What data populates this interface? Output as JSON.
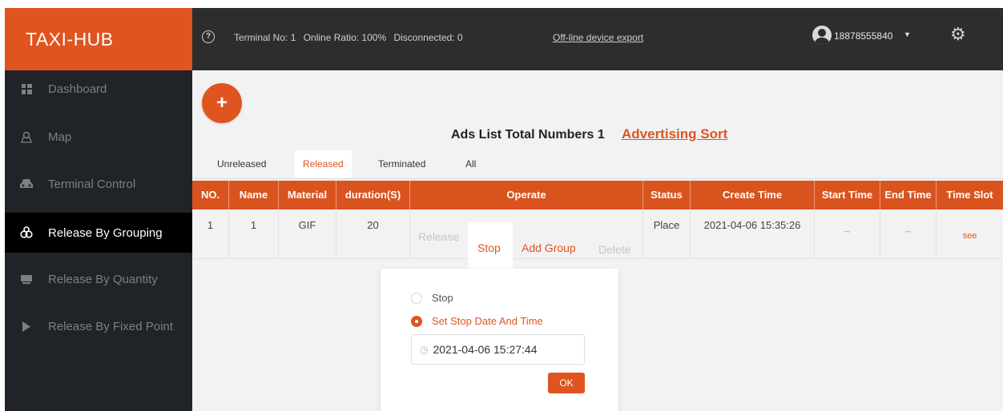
{
  "header": {
    "brand": "TAXI-HUB",
    "terminal_no": "Terminal No: 1",
    "online_ratio": "Online Ratio: 100%",
    "disconnected": "Disconnected: 0",
    "export_link": "Off-line device export",
    "user_phone": "18878555840",
    "icons": [
      "help-icon",
      "avatar",
      "chevron-down-icon",
      "gear-icon"
    ]
  },
  "sidebar": {
    "items": [
      {
        "label": "Dashboard",
        "icon": "dashboard-icon"
      },
      {
        "label": "Map",
        "icon": "map-icon"
      },
      {
        "label": "Terminal Control",
        "icon": "car-icon"
      },
      {
        "label": "Release By Grouping",
        "icon": "group-icon",
        "active": true
      },
      {
        "label": "Release By Quantity",
        "icon": "quantity-icon"
      },
      {
        "label": "Release By Fixed Point",
        "icon": "play-icon"
      }
    ]
  },
  "main": {
    "add_symbol": "+",
    "ads_title": "Ads List Total Numbers 1",
    "sort_link": "Advertising Sort",
    "tabs": [
      {
        "label": "Unreleased"
      },
      {
        "label": "Released",
        "active": true
      },
      {
        "label": "Terminated"
      },
      {
        "label": "All"
      }
    ],
    "table": {
      "headers": [
        "NO.",
        "Name",
        "Material",
        "duration(S)",
        "Operate",
        "Status",
        "Create Time",
        "Start Time",
        "End Time",
        "Time Slot"
      ],
      "rows": [
        {
          "no": "1",
          "name": "1",
          "material": "GIF",
          "duration": "20",
          "operate": {
            "release": "Release",
            "stop": "Stop",
            "add_group": "Add Group",
            "delete": "Delete"
          },
          "status": "Place",
          "create_time": "2021-04-06 15:35:26",
          "start_time": "~",
          "end_time": "~",
          "time_slot": "see"
        }
      ]
    }
  },
  "popover": {
    "option_stop": "Stop",
    "option_set": "Set Stop Date And Time",
    "selected": "Set Stop Date And Time",
    "datetime": "2021-04-06 15:27:44",
    "ok": "OK"
  },
  "colors": {
    "accent": "#e0541f",
    "header_bg": "#2d2d2d",
    "sidebar_bg": "#202328",
    "sidebar_active": "#000000",
    "content_bg": "#f2f2f2"
  }
}
